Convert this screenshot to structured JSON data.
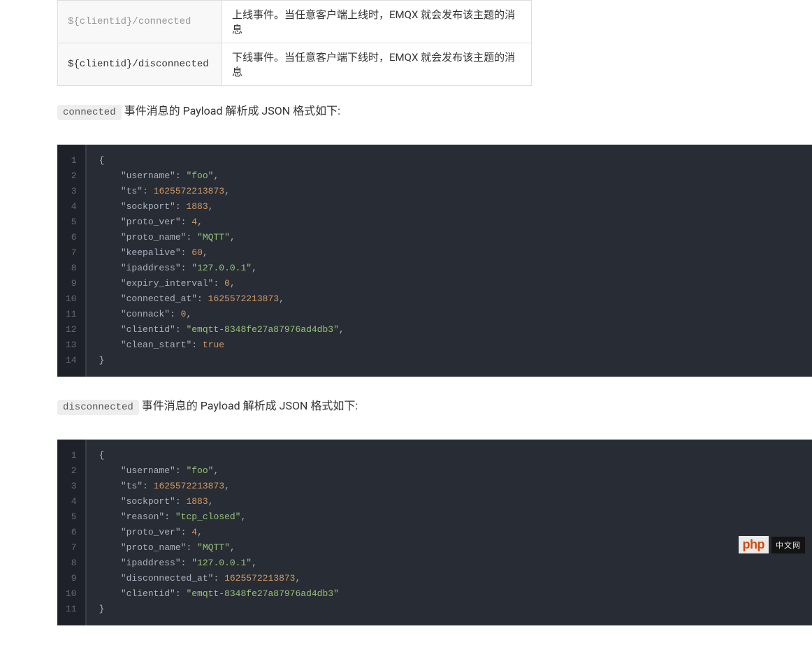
{
  "table": {
    "rows": [
      {
        "topic": "${clientid}/connected",
        "desc": "上线事件。当任意客户端上线时，EMQX 就会发布该主题的消息"
      },
      {
        "topic": "${clientid}/disconnected",
        "desc": "下线事件。当任意客户端下线时，EMQX 就会发布该主题的消息"
      }
    ]
  },
  "section1": {
    "code_label": "connected",
    "text": " 事件消息的 Payload 解析成 JSON 格式如下:"
  },
  "section2": {
    "code_label": "disconnected",
    "text": " 事件消息的 Payload 解析成 JSON 格式如下:"
  },
  "code1": {
    "line_count": 14,
    "lines": [
      {
        "raw": "{"
      },
      {
        "key": "username",
        "val": "\"foo\"",
        "type": "s",
        "comma": true
      },
      {
        "key": "ts",
        "val": "1625572213873",
        "type": "n",
        "comma": true
      },
      {
        "key": "sockport",
        "val": "1883",
        "type": "n",
        "comma": true
      },
      {
        "key": "proto_ver",
        "val": "4",
        "type": "n",
        "comma": true
      },
      {
        "key": "proto_name",
        "val": "\"MQTT\"",
        "type": "s",
        "comma": true
      },
      {
        "key": "keepalive",
        "val": "60",
        "type": "n",
        "comma": true
      },
      {
        "key": "ipaddress",
        "val": "\"127.0.0.1\"",
        "type": "s",
        "comma": true
      },
      {
        "key": "expiry_interval",
        "val": "0",
        "type": "n",
        "comma": true
      },
      {
        "key": "connected_at",
        "val": "1625572213873",
        "type": "n",
        "comma": true
      },
      {
        "key": "connack",
        "val": "0",
        "type": "n",
        "comma": true
      },
      {
        "key": "clientid",
        "val": "\"emqtt-8348fe27a87976ad4db3\"",
        "type": "s",
        "comma": true
      },
      {
        "key": "clean_start",
        "val": "true",
        "type": "n",
        "comma": false
      },
      {
        "raw": "}"
      }
    ]
  },
  "code2": {
    "line_count": 11,
    "lines": [
      {
        "raw": "{"
      },
      {
        "key": "username",
        "val": "\"foo\"",
        "type": "s",
        "comma": true
      },
      {
        "key": "ts",
        "val": "1625572213873",
        "type": "n",
        "comma": true
      },
      {
        "key": "sockport",
        "val": "1883",
        "type": "n",
        "comma": true
      },
      {
        "key": "reason",
        "val": "\"tcp_closed\"",
        "type": "s",
        "comma": true
      },
      {
        "key": "proto_ver",
        "val": "4",
        "type": "n",
        "comma": true
      },
      {
        "key": "proto_name",
        "val": "\"MQTT\"",
        "type": "s",
        "comma": true
      },
      {
        "key": "ipaddress",
        "val": "\"127.0.0.1\"",
        "type": "s",
        "comma": true
      },
      {
        "key": "disconnected_at",
        "val": "1625572213873",
        "type": "n",
        "comma": true
      },
      {
        "key": "clientid",
        "val": "\"emqtt-8348fe27a87976ad4db3\"",
        "type": "s",
        "comma": false
      },
      {
        "raw": "}"
      }
    ]
  },
  "watermark": {
    "left": "php",
    "right": "中文网"
  }
}
